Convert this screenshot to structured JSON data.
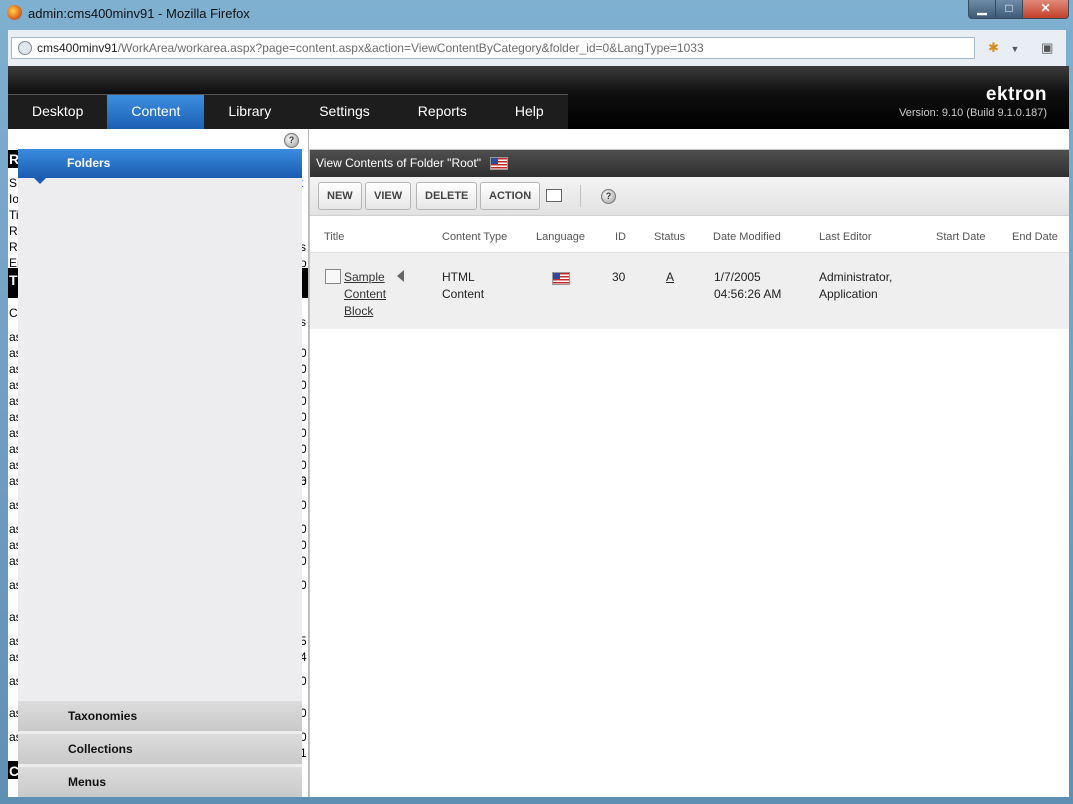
{
  "window": {
    "title": "admin:cms400minv91 - Mozilla Firefox",
    "controls": {
      "minimize": "▁",
      "maximize": "□",
      "close": "✕"
    }
  },
  "address_bar": {
    "host": "cms400minv91",
    "path": "/WorkArea/workarea.aspx?page=content.aspx&action=ViewContentByCategory&folder_id=0&LangType=1033"
  },
  "nav": {
    "tabs": [
      {
        "label": "Desktop",
        "active": false
      },
      {
        "label": "Content",
        "active": true
      },
      {
        "label": "Library",
        "active": false
      },
      {
        "label": "Settings",
        "active": false
      },
      {
        "label": "Reports",
        "active": false
      },
      {
        "label": "Help",
        "active": false
      }
    ],
    "brand": "ektron",
    "version": "Version: 9.10 (Build 9.1.0.187)"
  },
  "left_panel": {
    "ghost_left": [
      "R",
      "S",
      "Io",
      "Ti",
      "R",
      "R",
      "Er",
      "T",
      "C",
      "as",
      "as",
      "as",
      "as",
      "as",
      "as",
      "as",
      "as",
      "as",
      "as",
      "as",
      "as",
      "as",
      "as",
      "as",
      "as",
      "as",
      "as",
      "as",
      "as",
      "as",
      "C"
    ],
    "ghost_right": [
      "t",
      "s",
      "o",
      "s",
      "0",
      "0",
      "0",
      "0",
      "0",
      "0",
      "0",
      "0",
      "0",
      "6",
      "0",
      "0",
      "0",
      "0",
      "0",
      "5",
      "4",
      "0",
      "0",
      "0",
      "1"
    ],
    "accordion": {
      "active": "Folders",
      "items": [
        "Taxonomies",
        "Collections",
        "Menus"
      ]
    }
  },
  "main": {
    "folder_title": "View Contents of Folder \"Root\"",
    "toolbar": {
      "new": "NEW",
      "view": "VIEW",
      "delete": "DELETE",
      "action": "ACTION"
    },
    "columns": [
      "Title",
      "Content Type",
      "Language",
      "ID",
      "Status",
      "Date Modified",
      "Last Editor",
      "Start Date",
      "End Date"
    ],
    "rows": [
      {
        "title_lines": [
          "Sample",
          "Content",
          "Block"
        ],
        "content_type_lines": [
          "HTML",
          "Content"
        ],
        "language_flag": "us-flag-icon",
        "id": "30",
        "status": "A",
        "date_lines": [
          "1/7/2005",
          "04:56:26 AM"
        ],
        "editor_lines": [
          "Administrator,",
          "Application"
        ],
        "start_date": "",
        "end_date": ""
      }
    ]
  }
}
